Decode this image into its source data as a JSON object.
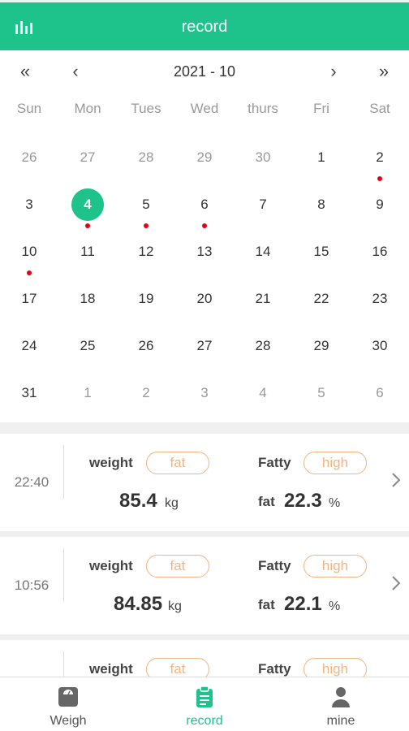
{
  "header": {
    "title": "record",
    "icon": "bar-chart-icon"
  },
  "calendar": {
    "month_label": "2021 - 10",
    "nav": {
      "prev_year": "«",
      "prev_month": "‹",
      "next_month": "›",
      "next_year": "»"
    },
    "weekdays": [
      "Sun",
      "Mon",
      "Tues",
      "Wed",
      "thurs",
      "Fri",
      "Sat"
    ],
    "weeks": [
      [
        {
          "d": "26",
          "other": true
        },
        {
          "d": "27",
          "other": true
        },
        {
          "d": "28",
          "other": true
        },
        {
          "d": "29",
          "other": true
        },
        {
          "d": "30",
          "other": true
        },
        {
          "d": "1"
        },
        {
          "d": "2",
          "dot": true
        }
      ],
      [
        {
          "d": "3"
        },
        {
          "d": "4",
          "selected": true,
          "dot": true
        },
        {
          "d": "5",
          "dot": true
        },
        {
          "d": "6",
          "dot": true
        },
        {
          "d": "7"
        },
        {
          "d": "8"
        },
        {
          "d": "9"
        }
      ],
      [
        {
          "d": "10",
          "dot": true
        },
        {
          "d": "11"
        },
        {
          "d": "12"
        },
        {
          "d": "13"
        },
        {
          "d": "14"
        },
        {
          "d": "15"
        },
        {
          "d": "16"
        }
      ],
      [
        {
          "d": "17"
        },
        {
          "d": "18"
        },
        {
          "d": "19"
        },
        {
          "d": "20"
        },
        {
          "d": "21"
        },
        {
          "d": "22"
        },
        {
          "d": "23"
        }
      ],
      [
        {
          "d": "24"
        },
        {
          "d": "25"
        },
        {
          "d": "26"
        },
        {
          "d": "27"
        },
        {
          "d": "28"
        },
        {
          "d": "29"
        },
        {
          "d": "30"
        }
      ],
      [
        {
          "d": "31"
        },
        {
          "d": "1",
          "other": true
        },
        {
          "d": "2",
          "other": true
        },
        {
          "d": "3",
          "other": true
        },
        {
          "d": "4",
          "other": true
        },
        {
          "d": "5",
          "other": true
        },
        {
          "d": "6",
          "other": true
        }
      ]
    ]
  },
  "records": [
    {
      "time": "22:40",
      "weight_label": "weight",
      "weight_tag": "fat",
      "fatty_label": "Fatty",
      "fatty_tag": "high",
      "weight_value": "85.4",
      "weight_unit": "kg",
      "fat_label": "fat",
      "fat_value": "22.3",
      "fat_unit": "%"
    },
    {
      "time": "10:56",
      "weight_label": "weight",
      "weight_tag": "fat",
      "fatty_label": "Fatty",
      "fatty_tag": "high",
      "weight_value": "84.85",
      "weight_unit": "kg",
      "fat_label": "fat",
      "fat_value": "22.1",
      "fat_unit": "%"
    },
    {
      "time": "",
      "weight_label": "weight",
      "weight_tag": "fat",
      "fatty_label": "Fatty",
      "fatty_tag": "high",
      "weight_value": "",
      "weight_unit": "",
      "fat_label": "",
      "fat_value": "",
      "fat_unit": ""
    }
  ],
  "tabbar": {
    "tabs": [
      {
        "label": "Weigh",
        "icon": "scale-icon"
      },
      {
        "label": "record",
        "icon": "clipboard-icon",
        "active": true
      },
      {
        "label": "mine",
        "icon": "person-icon"
      }
    ]
  },
  "colors": {
    "accent": "#1ec28b",
    "tag": "#f4b37f",
    "dot": "#e60012"
  }
}
